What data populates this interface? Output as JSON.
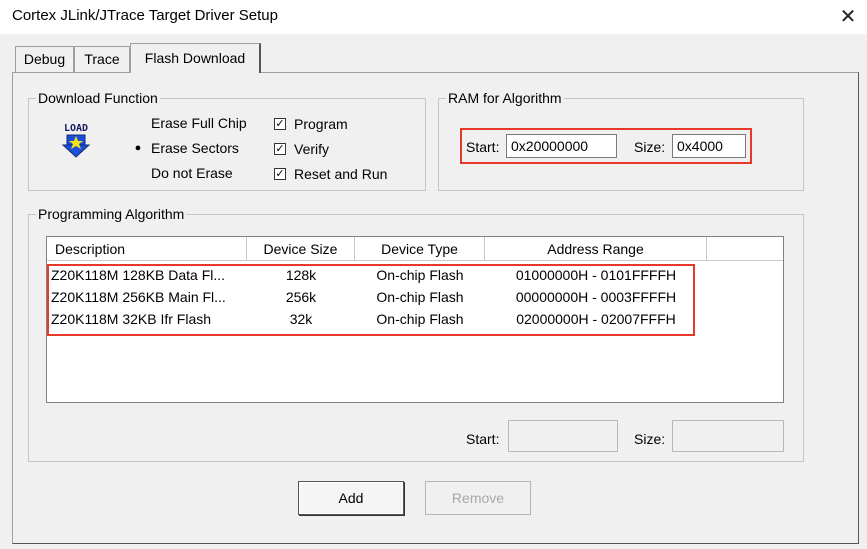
{
  "window": {
    "title": "Cortex JLink/JTrace Target Driver Setup",
    "close_glyph": "✕"
  },
  "tabs": [
    {
      "label": "Debug"
    },
    {
      "label": "Trace"
    },
    {
      "label": "Flash Download"
    }
  ],
  "download_function": {
    "legend": "Download Function",
    "icon_text": "LOAD",
    "options": [
      {
        "label": "Erase Full Chip",
        "selected": false
      },
      {
        "label": "Erase Sectors",
        "selected": true
      },
      {
        "label": "Do not Erase",
        "selected": false
      }
    ],
    "checks": [
      {
        "label": "Program",
        "checked": true
      },
      {
        "label": "Verify",
        "checked": true
      },
      {
        "label": "Reset and Run",
        "checked": true
      }
    ]
  },
  "ram": {
    "legend": "RAM for Algorithm",
    "start_label": "Start:",
    "start_value": "0x20000000",
    "size_label": "Size:",
    "size_value": "0x4000"
  },
  "programming": {
    "legend": "Programming Algorithm",
    "columns": [
      "Description",
      "Device Size",
      "Device Type",
      "Address Range"
    ],
    "rows": [
      {
        "description": "Z20K118M 128KB Data Fl...",
        "size": "128k",
        "type": "On-chip Flash",
        "range": "01000000H - 0101FFFFH"
      },
      {
        "description": "Z20K118M 256KB Main Fl...",
        "size": "256k",
        "type": "On-chip Flash",
        "range": "00000000H - 0003FFFFH"
      },
      {
        "description": "Z20K118M 32KB Ifr Flash",
        "size": "32k",
        "type": "On-chip Flash",
        "range": "02000000H - 02007FFFH"
      }
    ],
    "start_label": "Start:",
    "start_value": "",
    "size_label": "Size:",
    "size_value": ""
  },
  "buttons": {
    "add": "Add",
    "remove": "Remove"
  },
  "colors": {
    "highlight": "#e53a2a",
    "icon_blue": "#1e4fd8",
    "icon_star": "#f7e21a"
  }
}
